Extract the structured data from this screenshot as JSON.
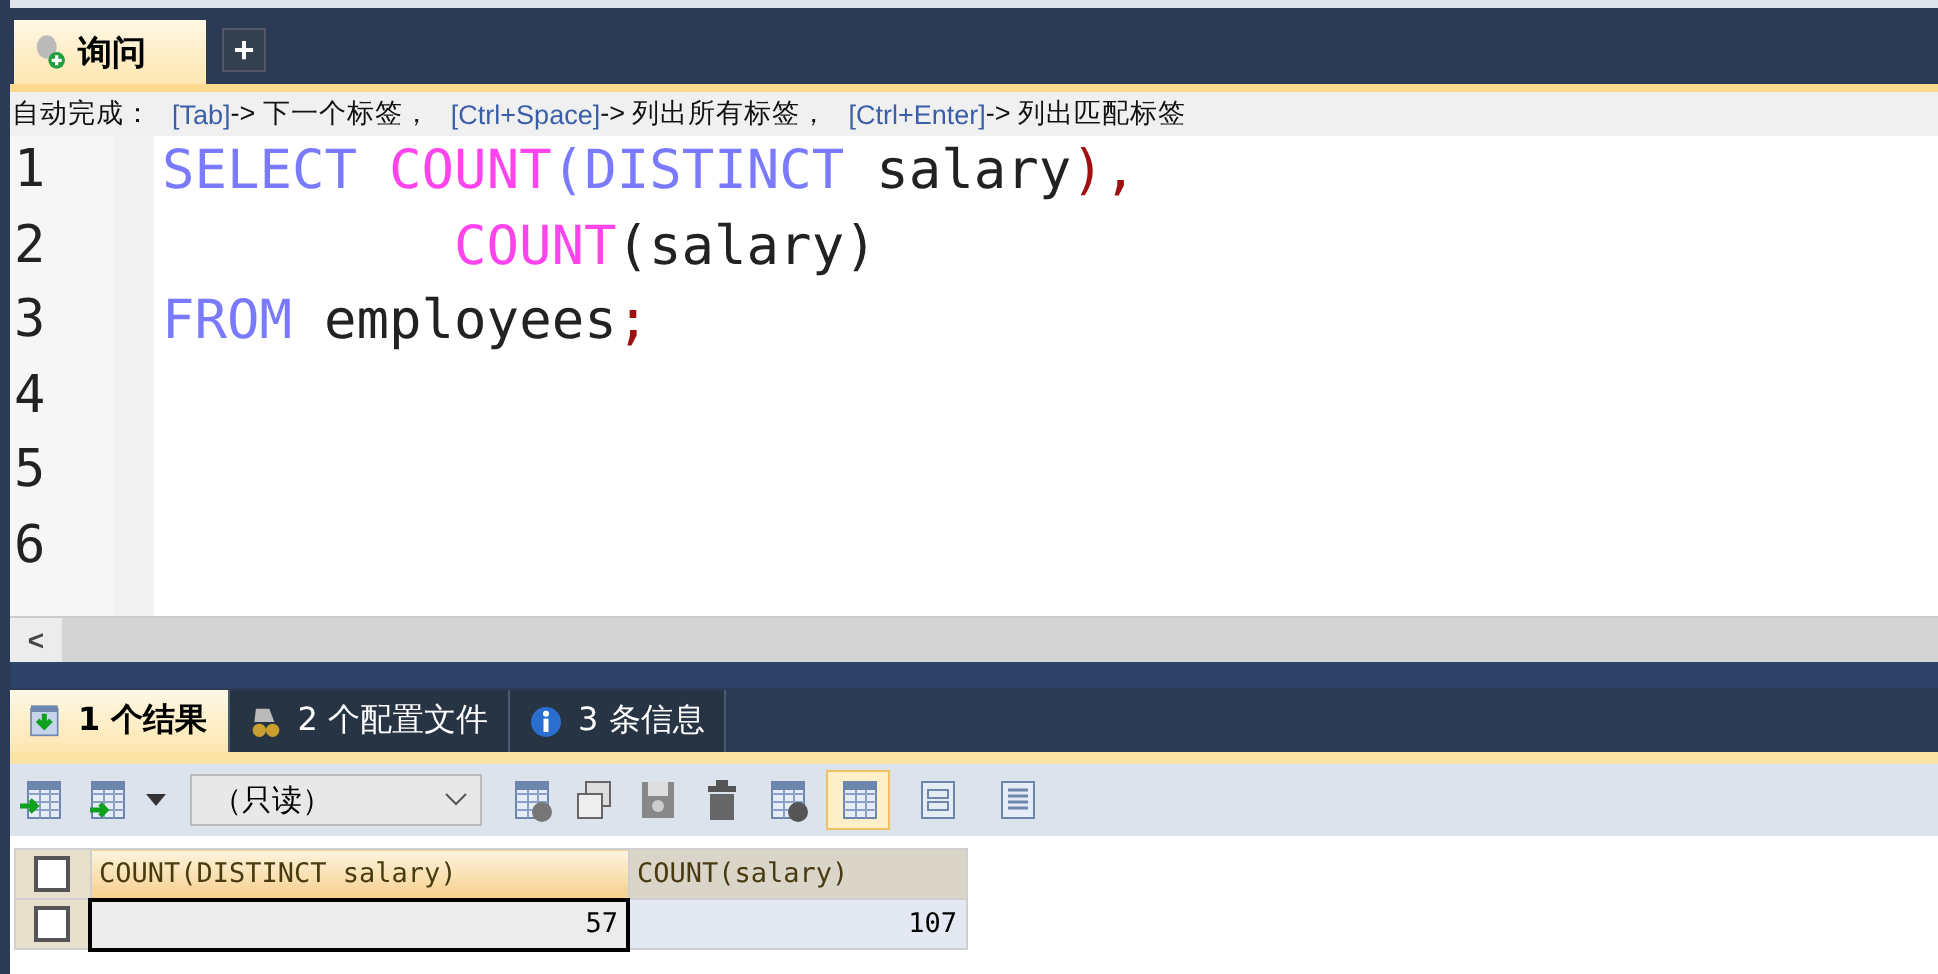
{
  "editor_tabs": [
    {
      "label": "询问",
      "selected": true
    }
  ],
  "add_tab": "+",
  "hint": [
    {
      "text": "自动完成：",
      "kind": "plain"
    },
    {
      "text": "[Tab]",
      "kind": "key"
    },
    {
      "text": "-> 下一个标签，",
      "kind": "plain"
    },
    {
      "text": "[Ctrl+Space]",
      "kind": "key"
    },
    {
      "text": "-> 列出所有标签，",
      "kind": "plain"
    },
    {
      "text": "[Ctrl+Enter]",
      "kind": "key"
    },
    {
      "text": "-> 列出匹配标签",
      "kind": "plain"
    }
  ],
  "code_lines": [
    {
      "number": "1",
      "tokens": [
        {
          "text": "SELECT",
          "kind": "keyword"
        },
        {
          "text": "COUNT",
          "kind": "function"
        },
        {
          "text": "(",
          "kind": "keyword",
          "join": true
        },
        {
          "text": "DISTINCT",
          "kind": "keyword",
          "join": true
        },
        {
          "text": "salary",
          "kind": "ident"
        },
        {
          "text": "),",
          "kind": "punct",
          "join": true
        }
      ]
    },
    {
      "number": "2",
      "indent": true,
      "tokens": [
        {
          "text": "COUNT",
          "kind": "function"
        },
        {
          "text": "(salary)",
          "kind": "ident",
          "join": true
        }
      ]
    },
    {
      "number": "3",
      "tokens": [
        {
          "text": "FROM",
          "kind": "keyword"
        },
        {
          "text": "employees",
          "kind": "ident"
        },
        {
          "text": ";",
          "kind": "punct",
          "join": true
        }
      ]
    },
    {
      "number": "4"
    },
    {
      "number": "5"
    },
    {
      "number": "6"
    }
  ],
  "scroll_left": "<",
  "result_tabs": [
    {
      "count": "1",
      "label": "个结果",
      "kind": "result",
      "selected": true
    },
    {
      "count": "2",
      "label": "个配置文件",
      "kind": "profile",
      "selected": false
    },
    {
      "count": "3",
      "label": "条信息",
      "kind": "info",
      "selected": false
    }
  ],
  "toolbar": {
    "mode_select": "（只读）",
    "views": [
      {
        "kind": "grid",
        "selected": true
      },
      {
        "kind": "form",
        "selected": false
      },
      {
        "kind": "text",
        "selected": false
      }
    ]
  },
  "table": {
    "select_all_checked": false,
    "columns": [
      {
        "label": "COUNT(DISTINCT salary)",
        "selected": true
      },
      {
        "label": "COUNT(salary)",
        "selected": false
      }
    ],
    "rows": [
      {
        "checked": false,
        "cells": [
          {
            "text": "57",
            "selected": true
          },
          {
            "text": "107",
            "selected": false
          }
        ]
      }
    ]
  }
}
